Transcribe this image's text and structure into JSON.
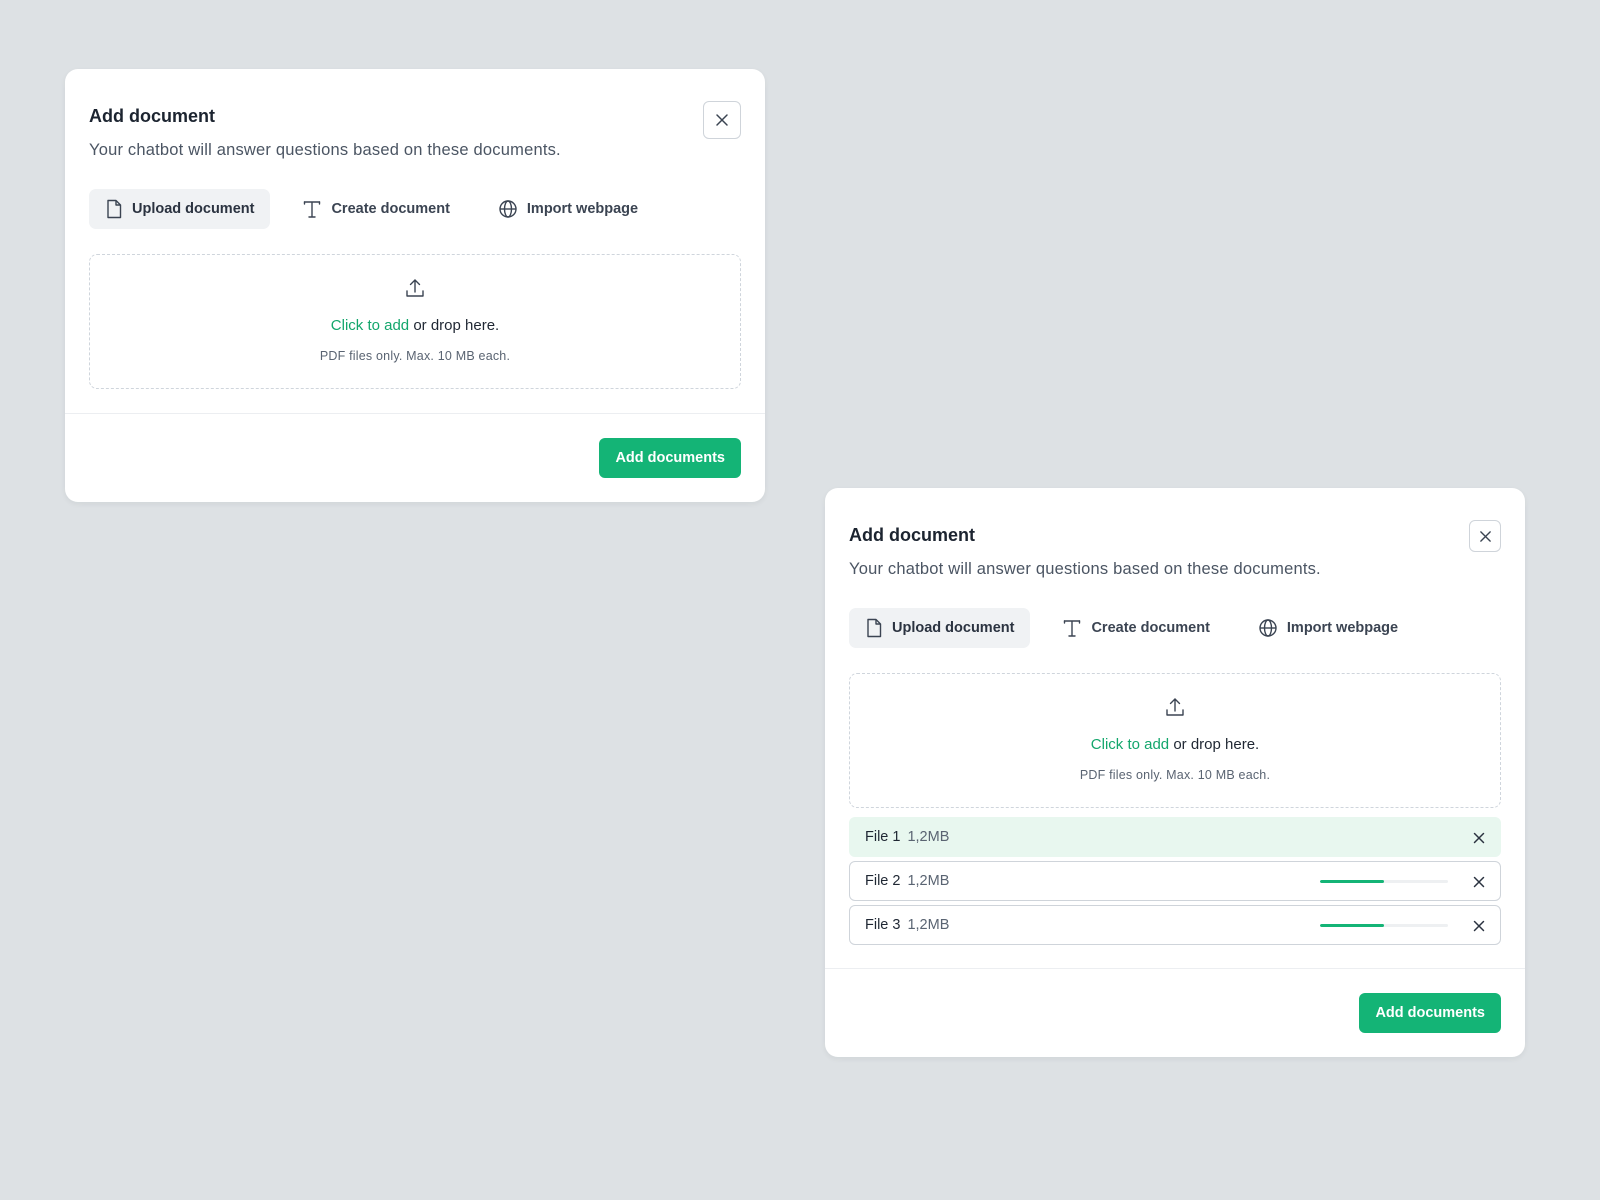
{
  "colors": {
    "accent": "#14b476",
    "link": "#13a66c",
    "background": "#dde1e4",
    "done_row": "#e8f7ef"
  },
  "modals": [
    {
      "title": "Add document",
      "description": "Your chatbot will answer questions based on these documents.",
      "tabs": [
        {
          "label": "Upload document",
          "icon": "file-icon",
          "active": true
        },
        {
          "label": "Create document",
          "icon": "text-icon",
          "active": false
        },
        {
          "label": "Import webpage",
          "icon": "globe-icon",
          "active": false
        }
      ],
      "dropzone": {
        "link": "Click to add",
        "text": " or drop here.",
        "hint": "PDF files only. Max. 10 MB each."
      },
      "files": [],
      "submit_label": "Add documents"
    },
    {
      "title": "Add document",
      "description": "Your chatbot will answer questions based on these documents.",
      "tabs": [
        {
          "label": "Upload document",
          "icon": "file-icon",
          "active": true
        },
        {
          "label": "Create document",
          "icon": "text-icon",
          "active": false
        },
        {
          "label": "Import webpage",
          "icon": "globe-icon",
          "active": false
        }
      ],
      "dropzone": {
        "link": "Click to add",
        "text": " or drop here.",
        "hint": "PDF files only. Max. 10 MB each."
      },
      "files": [
        {
          "name": "File 1",
          "size": "1,2MB",
          "complete": true,
          "progress": 1.0
        },
        {
          "name": "File 2",
          "size": "1,2MB",
          "complete": false,
          "progress": 0.5
        },
        {
          "name": "File 3",
          "size": "1,2MB",
          "complete": false,
          "progress": 0.5
        }
      ],
      "submit_label": "Add documents"
    }
  ]
}
